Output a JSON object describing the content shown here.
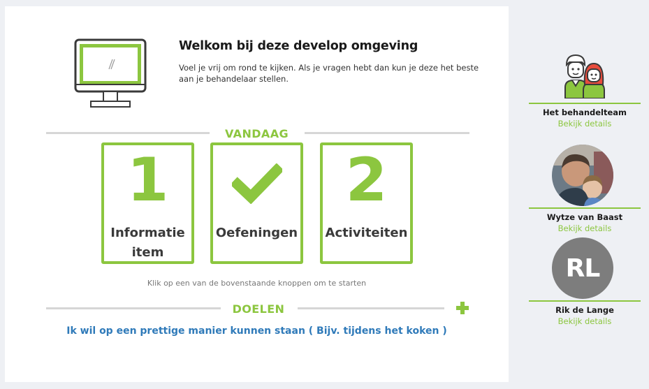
{
  "welcome": {
    "title": "Welkom bij deze develop omgeving",
    "text": "Voel je vrij om rond te kijken. Als je vragen hebt dan kun je deze het beste aan je behandelaar stellen."
  },
  "today": {
    "section_title": "VANDAAG",
    "tiles": [
      {
        "value": "1",
        "label_line1": "Informatie",
        "label_line2": "item"
      },
      {
        "icon": "checkmark-icon",
        "label_line1": "Oefeningen"
      },
      {
        "value": "2",
        "label_line1": "Activiteiten"
      }
    ],
    "hint": "Klik op een van de bovenstaande knoppen om te starten"
  },
  "goals": {
    "section_title": "DOELEN",
    "items": [
      "Ik wil op een prettige manier kunnen staan ( Bijv. tijdens het koken )"
    ]
  },
  "sidebar": {
    "members": [
      {
        "name": "Het behandelteam",
        "link": "Bekijk details",
        "icon": "team-icon"
      },
      {
        "name": "Wytze van Baast",
        "link": "Bekijk details",
        "icon": "photo-avatar"
      },
      {
        "name": "Rik de Lange",
        "link": "Bekijk details",
        "initials": "RL"
      }
    ]
  },
  "colors": {
    "accent": "#8cc63f",
    "link_blue": "#2f7ab9",
    "initials_bg": "#7d7d7d"
  }
}
